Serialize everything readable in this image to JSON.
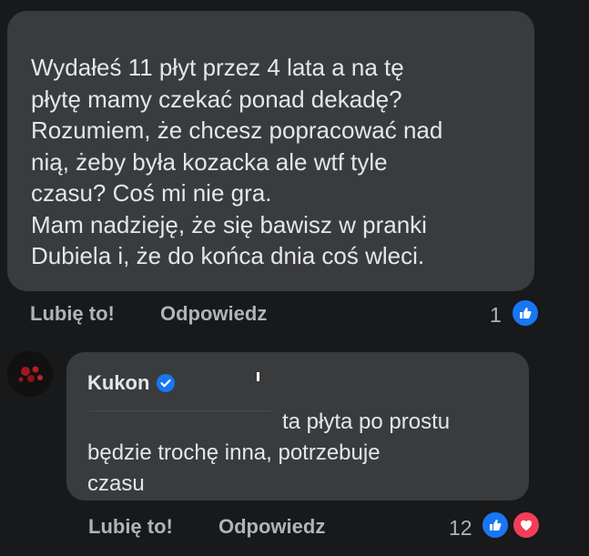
{
  "comment": {
    "lines": [
      "Wydałeś 11 płyt przez 4 lata a na tę",
      "płytę mamy czekać ponad dekadę?",
      "Rozumiem, że chcesz popracować nad",
      "nią, żeby była kozacka ale wtf tyle",
      "czasu? Coś mi nie gra.",
      "Mam nadzieję, że się bawisz w pranki",
      "Dubiela i, że do końca dnia coś wleci."
    ],
    "like_label": "Lubię to!",
    "reply_label": "Odpowiedz",
    "reaction_count": "1",
    "reactions": [
      "like-icon"
    ],
    "colors": {
      "like": "#1877f2"
    }
  },
  "reply": {
    "author": "Kukon",
    "verified": true,
    "lines": [
      "ta płyta po prostu",
      "będzie trochę inna, potrzebuje",
      "czasu"
    ],
    "like_label": "Lubię to!",
    "reply_label": "Odpowiedz",
    "reaction_count": "12",
    "reactions": [
      "like-icon",
      "love-icon"
    ],
    "colors": {
      "like": "#1877f2",
      "love": "#f33e58",
      "verified": "#1877f2"
    }
  }
}
